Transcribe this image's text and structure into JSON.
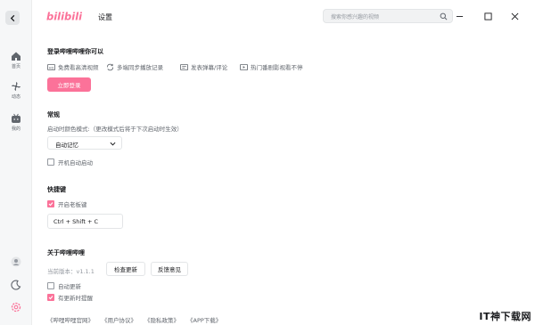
{
  "colors": {
    "accent": "#fb7299",
    "text": "#18191c",
    "muted": "#61666d"
  },
  "header": {
    "title": "设置",
    "logo_text": "bilibili",
    "search_placeholder": "搜索你感兴趣的视频"
  },
  "sidebar": {
    "items": [
      {
        "label": "首页",
        "icon": "home-icon"
      },
      {
        "label": "动态",
        "icon": "fan-icon"
      },
      {
        "label": "我的",
        "icon": "tv-icon"
      }
    ]
  },
  "login": {
    "title": "登录哔哩哔哩你可以",
    "features": [
      "免费看高清视频",
      "多端同步播放记录",
      "发表弹幕/评论",
      "热门番剧影视看不停"
    ],
    "button": "立即登录"
  },
  "general": {
    "title": "常规",
    "theme_label": "启动时颜色模式:（更改模式后将于下次启动时生效）",
    "theme_value": "自动记忆",
    "autostart_label": "开机自动启动",
    "autostart_checked": false
  },
  "shortcuts": {
    "title": "快捷键",
    "boss_key_label": "开启老板键",
    "boss_key_checked": true,
    "boss_key_value": "Ctrl + Shift + C"
  },
  "about": {
    "title": "关于哔哩哔哩",
    "version_text": "当前版本：v1.1.1",
    "check_update": "检查更新",
    "feedback": "反馈意见",
    "auto_update_label": "自动更新",
    "auto_update_checked": false,
    "notify_label": "有更新时提醒",
    "notify_checked": true
  },
  "footer": {
    "links": [
      "《哔哩哔哩官网》",
      "《用户协议》",
      "《隐私政策》",
      "《APP下载》"
    ]
  },
  "watermark": "IT神下载网"
}
